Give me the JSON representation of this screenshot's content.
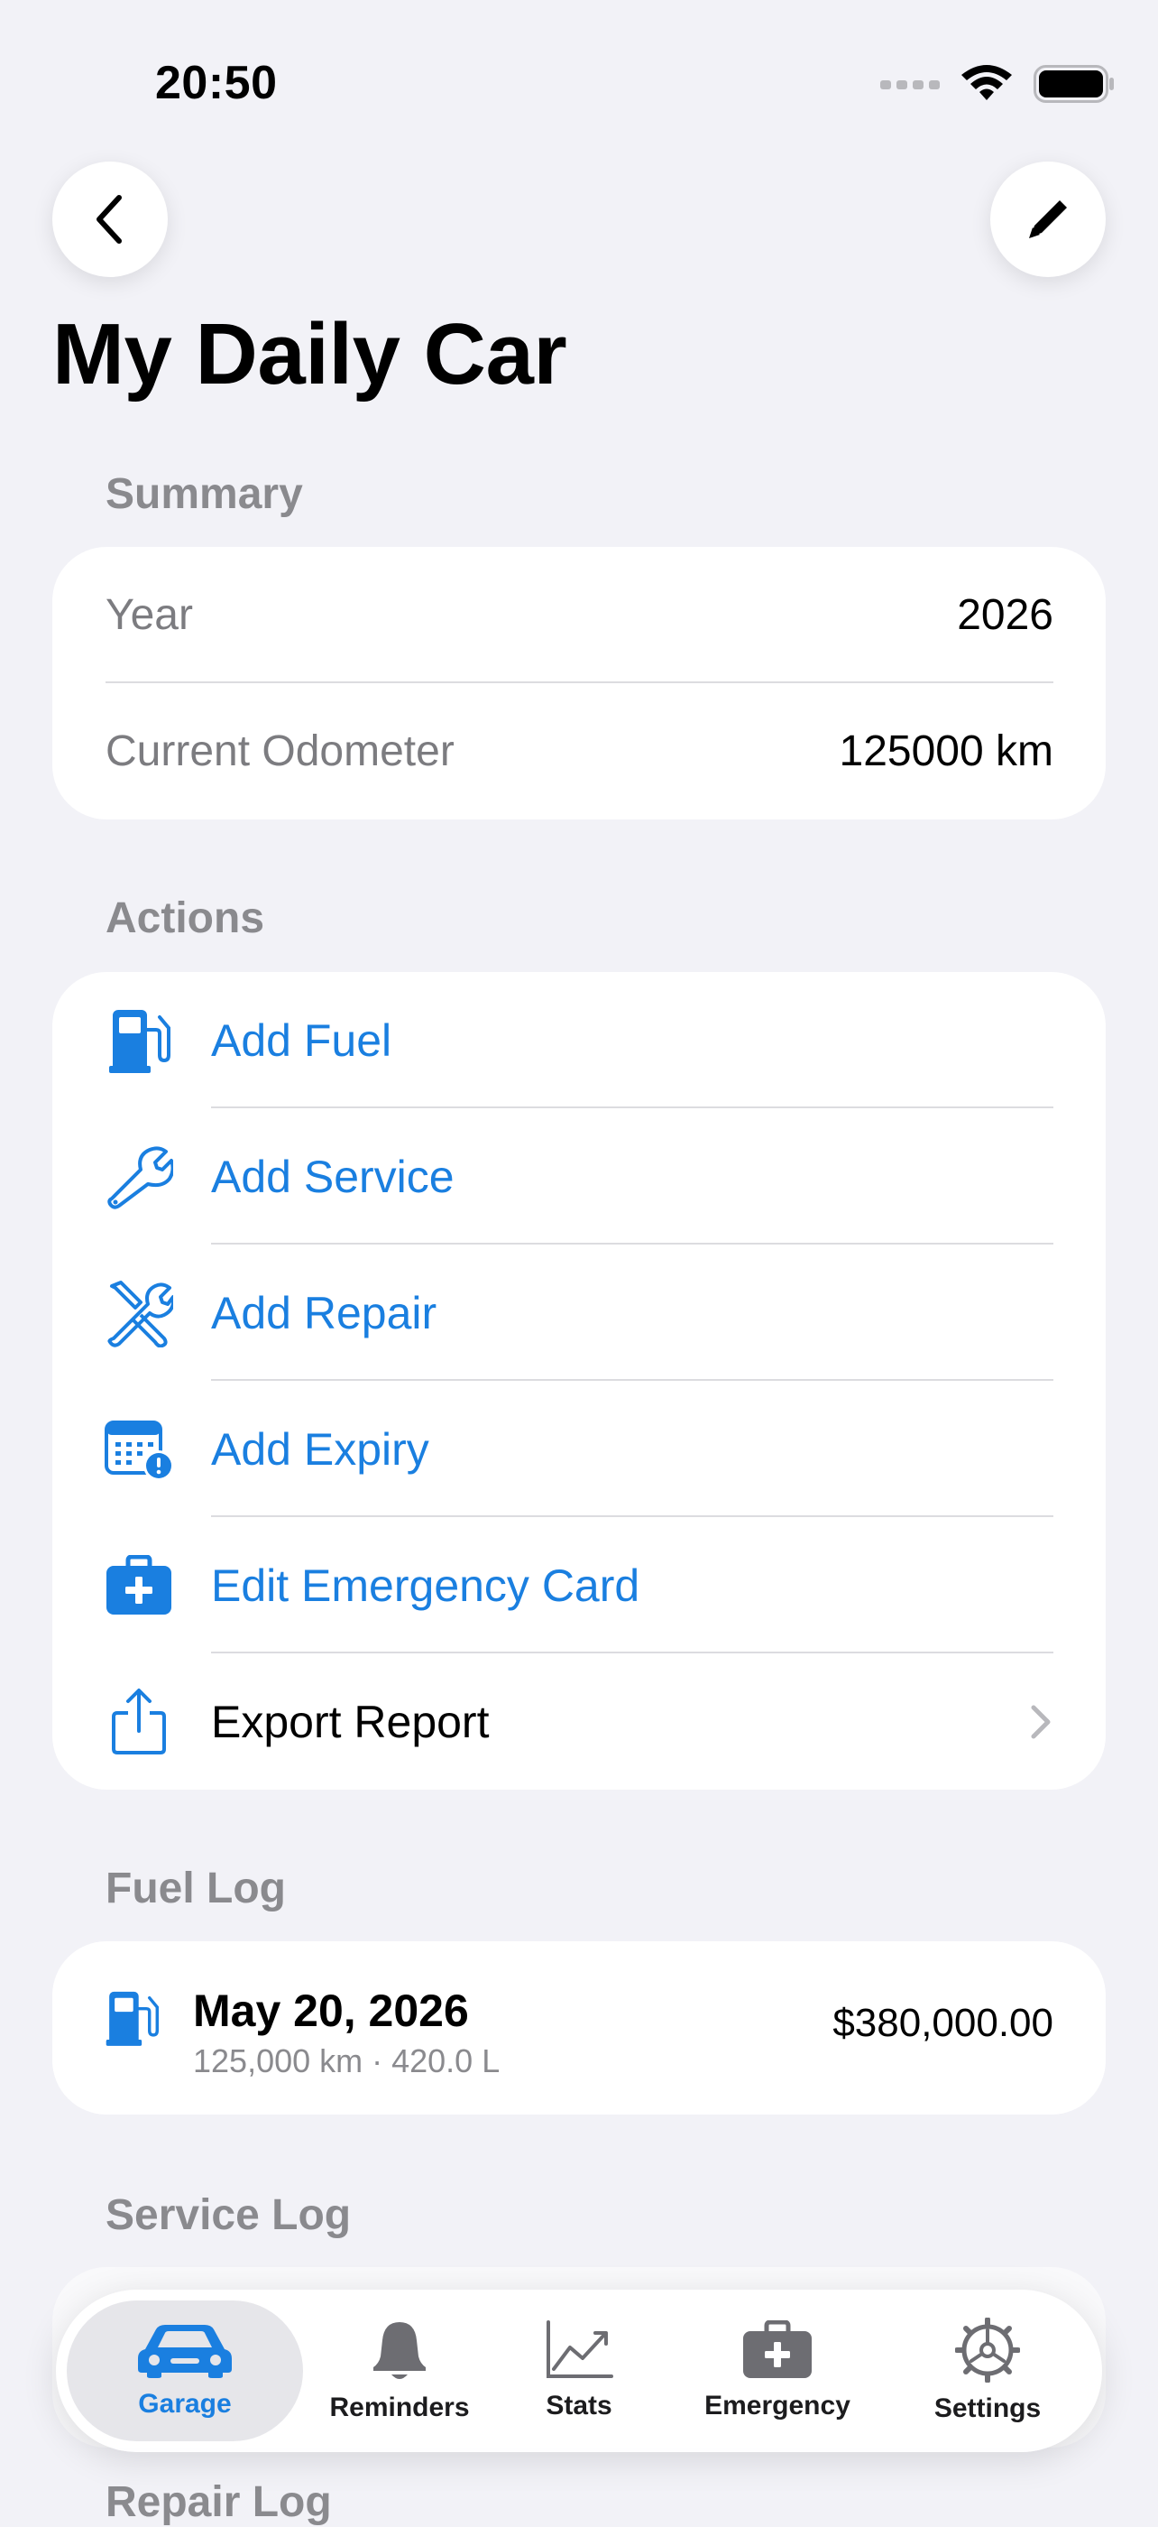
{
  "status_bar": {
    "time": "20:50"
  },
  "header": {
    "title": "My Daily Car"
  },
  "summary": {
    "header": "Summary",
    "rows": [
      {
        "label": "Year",
        "value": "2026"
      },
      {
        "label": "Current Odometer",
        "value": "125000 km"
      }
    ]
  },
  "actions": {
    "header": "Actions",
    "items": [
      {
        "label": "Add Fuel",
        "icon": "fuel-pump-icon"
      },
      {
        "label": "Add Service",
        "icon": "wrench-icon"
      },
      {
        "label": "Add Repair",
        "icon": "wrench-screwdriver-icon"
      },
      {
        "label": "Add Expiry",
        "icon": "calendar-alert-icon"
      },
      {
        "label": "Edit Emergency Card",
        "icon": "medical-bag-icon"
      },
      {
        "label": "Export Report",
        "icon": "share-icon"
      }
    ]
  },
  "fuel_log": {
    "header": "Fuel Log",
    "entries": [
      {
        "date": "May 20, 2026",
        "details": "125,000 km · 420.0 L",
        "amount": "$380,000.00"
      }
    ]
  },
  "service_log": {
    "header": "Service Log"
  },
  "repair_log": {
    "header": "Repair Log"
  },
  "tabbar": {
    "tabs": [
      {
        "label": "Garage",
        "icon": "car-icon",
        "active": true
      },
      {
        "label": "Reminders",
        "icon": "bell-icon",
        "active": false
      },
      {
        "label": "Stats",
        "icon": "chart-icon",
        "active": false
      },
      {
        "label": "Emergency",
        "icon": "medical-bag-icon",
        "active": false
      },
      {
        "label": "Settings",
        "icon": "gear-icon",
        "active": false
      }
    ]
  },
  "colors": {
    "accent": "#1A7FE0",
    "background": "#F2F2F7",
    "card": "#FFFFFF",
    "secondary_text": "#8A8A8E"
  }
}
